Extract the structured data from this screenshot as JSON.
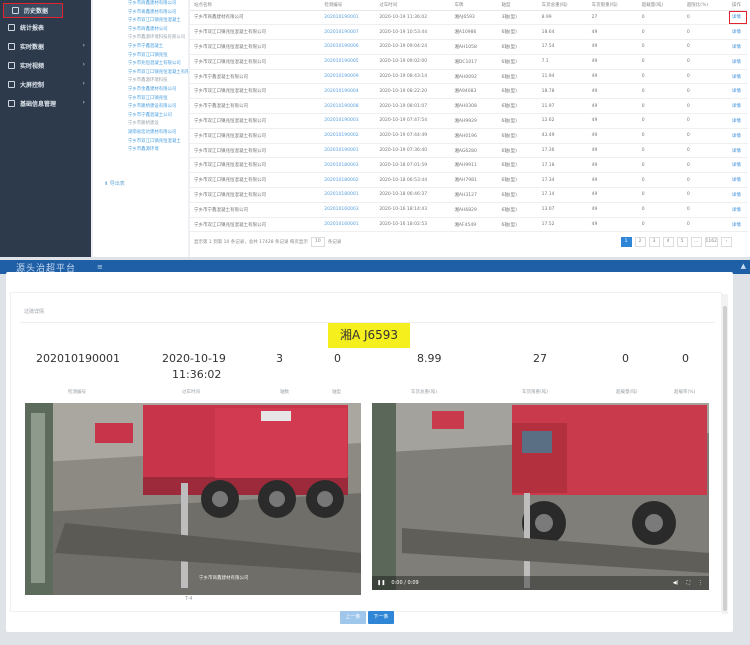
{
  "sidebar": {
    "items": [
      {
        "label": "历史数据",
        "icon": "document-icon",
        "active": true
      },
      {
        "label": "统计报表",
        "icon": "chart-icon"
      },
      {
        "label": "实时数据",
        "icon": "monitor-icon"
      },
      {
        "label": "实时视频",
        "icon": "video-icon"
      },
      {
        "label": "大屏控制",
        "icon": "screen-icon"
      },
      {
        "label": "基础信息管理",
        "icon": "gear-icon"
      }
    ]
  },
  "tree": {
    "items": [
      "宁乡市商鑫建材有限公司",
      "宁乡市黄鑫建材有限公司",
      "宁乡市双江口镇兆恒混凝土",
      "宁乡市商鑫建材公司",
      "宁乡市鑫源环境科技有限公司",
      "宁乡市宁鑫混凝土",
      "宁乡市双江口镇兆恒",
      "宁乡市兆恒混凝土有限公司",
      "宁乡市双江口镇兆恒混凝土有限公司",
      "宁乡市鑫源环境科技",
      "宁乡市金鑫建材有限公司",
      "宁乡市双江口镇兆恒",
      "宁乡市路桥建设有限公司",
      "宁乡市宁鑫混凝土公司",
      "宁乡市路桥建设",
      "湖南省宏达建材有限公司",
      "宁乡市双江口镇兆恒混凝土",
      "宁乡市鑫源环境"
    ],
    "footer": "导出表"
  },
  "table": {
    "headers": [
      "站点名称",
      "检测编号",
      "过车时间",
      "车牌",
      "轴型",
      "车货总重(吨)",
      "车货限重(吨)",
      "超载量(吨)",
      "超限比(%)",
      "操作"
    ],
    "rows": [
      [
        "宁乡市商鑫建材有限公司",
        "202010190001",
        "2020-10-19 11:36:02",
        "湘AJ6593",
        "3轴(型)",
        "8.99",
        "27",
        "0",
        "0",
        "详情"
      ],
      [
        "宁乡市双江口镇兆恒混凝土有限公司",
        "202010190007",
        "2020-10-19 10:53:44",
        "湘A10986",
        "6轴(型)",
        "18.64",
        "49",
        "0",
        "0",
        "详情"
      ],
      [
        "宁乡市双江口镇兆恒混凝土有限公司",
        "202010190006",
        "2020-10-19 09:04:24",
        "湘AH1058",
        "6轴(型)",
        "17.54",
        "49",
        "0",
        "0",
        "详情"
      ],
      [
        "宁乡市双江口镇兆恒混凝土有限公司",
        "202010190005",
        "2020-10-19 09:02:00",
        "湘DC1017",
        "6轴(型)",
        "7.1",
        "49",
        "0",
        "0",
        "详情"
      ],
      [
        "宁乡市宁鑫混凝土有限公司",
        "202010190009",
        "2020-10-19 08:43:14",
        "湘AH0092",
        "6轴(型)",
        "11.94",
        "49",
        "0",
        "0",
        "详情"
      ],
      [
        "宁乡市双江口镇兆恒混凝土有限公司",
        "202010190004",
        "2020-10-19 08:22:20",
        "湘A94083",
        "6轴(型)",
        "18.78",
        "49",
        "0",
        "0",
        "详情"
      ],
      [
        "宁乡市宁鑫混凝土有限公司",
        "202010190008",
        "2020-10-19 08:01:07",
        "湘AH0308",
        "6轴(型)",
        "11.97",
        "49",
        "0",
        "0",
        "详情"
      ],
      [
        "宁乡市双江口镇兆恒混凝土有限公司",
        "202010190003",
        "2020-10-19 07:47:54",
        "湘AH9929",
        "6轴(型)",
        "12.62",
        "49",
        "0",
        "0",
        "详情"
      ],
      [
        "宁乡市双江口镇兆恒混凝土有限公司",
        "202010190002",
        "2020-10-19 07:44:49",
        "湘AH0196",
        "6轴(型)",
        "43.49",
        "49",
        "0",
        "0",
        "详情"
      ],
      [
        "宁乡市双江口镇兆恒混凝土有限公司",
        "202010190001",
        "2020-10-19 07:36:40",
        "湘AG6280",
        "6轴(型)",
        "17.36",
        "49",
        "0",
        "0",
        "详情"
      ],
      [
        "宁乡市双江口镇兆恒混凝土有限公司",
        "202010180003",
        "2020-10-18 07:01:59",
        "湘AH9911",
        "6轴(型)",
        "17.18",
        "49",
        "0",
        "0",
        "详情"
      ],
      [
        "宁乡市双江口镇兆恒混凝土有限公司",
        "202010180002",
        "2020-10-18 06:53:44",
        "湘AH7981",
        "6轴(型)",
        "17.34",
        "49",
        "0",
        "0",
        "详情"
      ],
      [
        "宁乡市双江口镇兆恒混凝土有限公司",
        "202010180001",
        "2020-10-18 06:46:37",
        "湘AH3127",
        "6轴(型)",
        "17.14",
        "49",
        "0",
        "0",
        "详情"
      ],
      [
        "宁乡市宁鑫混凝土有限公司",
        "202010160003",
        "2020-10-16 18:14:43",
        "湘AH6829",
        "6轴(型)",
        "13.07",
        "49",
        "0",
        "0",
        "详情"
      ],
      [
        "宁乡市双江口镇兆恒混凝土有限公司",
        "202010160001",
        "2020-10-16 18:02:53",
        "湘AF4549",
        "6轴(型)",
        "17.52",
        "49",
        "0",
        "0",
        "详情"
      ]
    ],
    "pager_text": "显示第 1 到第 10 条记录，总共 17428 条记录 每页显示",
    "page_size": "10",
    "page_size_suffix": "条记录",
    "pages": [
      "1",
      "2",
      "3",
      "4",
      "5",
      "…",
      "1162",
      "›"
    ]
  },
  "band": {
    "title": "源头治超平台",
    "menu_icon": "≡",
    "user_icon": "▲"
  },
  "modal": {
    "section_label": "过磅详情",
    "plate": "湘A J6593",
    "values": {
      "detect_no": "202010190001",
      "pass_time_date": "2020-10-19",
      "pass_time_clock": "11:36:02",
      "axles": "3",
      "axle_type": "0",
      "gross_weight": "8.99",
      "limit_weight": "27",
      "overload": "0",
      "overload_ratio": "0"
    },
    "labels": {
      "detect_no": "检测编号",
      "pass_time": "过车时间",
      "axles": "轴数",
      "axle_type": "轴型",
      "gross_weight": "车货总重(吨)",
      "limit_weight": "车货限重(吨)",
      "overload": "超载量(吨)",
      "overload_ratio": "超载率(%)"
    },
    "photo_watermark": "宁乡市商鑫建材有限公司",
    "photo_caption": "T-4",
    "video_time": "0:00 / 0:09",
    "prev_button": "上一条",
    "next_button": "下一条"
  }
}
